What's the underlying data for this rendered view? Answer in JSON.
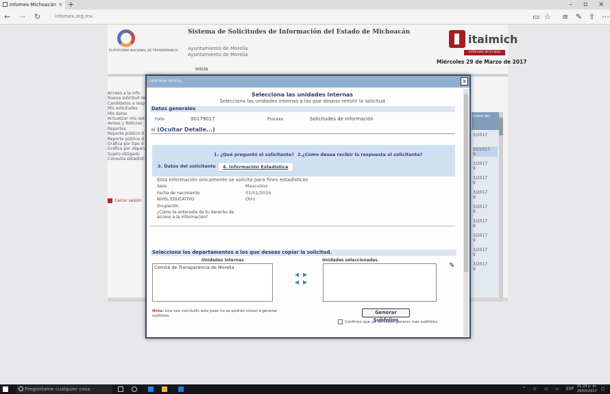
{
  "browser": {
    "tab_title": "Infomex Michoacán",
    "tab_close": "×",
    "new_tab": "+",
    "url": "infomex.org.mx",
    "min": "–",
    "max": "▫",
    "close": "×"
  },
  "page": {
    "logo_text": "PLATAFORMA NACIONAL DE TRANSPARENCIA",
    "site_title": "Sistema de Solicitudes de Información del Estado de Michoacán",
    "org_line1": "Ayuntamiento de Morelia",
    "org_line2": "Ayuntamiento de Morelia",
    "itai_name": "itaimich",
    "itai_tag": "Infórmate de tu lado",
    "date": "Miércoles 29 de Marzo de 2017",
    "inicio": "Inicio",
    "side_menu": [
      "Acceso a la info",
      "Nueva solicitud de",
      "Candidatos a resp",
      "Mis solicitudes",
      "Mis datos",
      "Actualizar mis dat",
      "Avisos y Noticias",
      "Reportes",
      "Reporte público d",
      "Reporte público d",
      "Gráfica por tipo d",
      "Gráfica por depen",
      "Sujeto obligado",
      "Consulta estadísti"
    ],
    "logout": "Cerrar sesión",
    "right_header": "cidad del",
    "right_cells": [
      "3/2017",
      "02/2017\n9",
      "3/2017\n9",
      "3/2017\n9",
      "3/2017\n9",
      "3/2017\n9",
      "3/2017\n9",
      "3/2017\n9",
      "3/2017\n9",
      "3/2017\n9"
    ]
  },
  "modal": {
    "title": "VENTANA MODAL",
    "close": "x",
    "heading": "Selecciona las unidades internas",
    "subheading": "Selecciona las unidades internas a las que deseas remitir la solicitud",
    "section_general": "Datos generales",
    "folio_label": "Folio",
    "folio_value": "00179017",
    "proceso_label": "Proceso",
    "proceso_value": "Solicitudes de Información",
    "toggle": "(Ocultar Detalle...)",
    "tabs": {
      "t1": "1. ¿Qué preguntó el solicitante?",
      "t2": "2.¿Cómo desea recibir la respuesta el solicitante?",
      "t3": "3. Datos del solicitante",
      "t4": "4. Información Estadística"
    },
    "info_note": "Esta información únicamente se solicita para fines estadísticos",
    "fields": [
      {
        "label": "Sexo",
        "value": "Masculino"
      },
      {
        "label": "Fecha de nacimiento",
        "value": "01/01/2016"
      },
      {
        "label": "NIVEL EDUCATIVO",
        "value": "Otro"
      },
      {
        "label": "Ocupación",
        "value": ""
      },
      {
        "label": "¿Cómo te enteraste de tu derecho de acceso a la información?",
        "value": ""
      }
    ],
    "dept_heading": "Selecciona los departamentos a los que deseas copiar la solicitud.",
    "internal_label": "Unidades internas",
    "selected_label": "Unidades seleccionadas",
    "internal_items": [
      "Comité de Transparencia de Morelia"
    ],
    "note_prefix": "Nota:",
    "note_text": "Una vez concluido este paso no se podrán volver a generar subfolios.",
    "generate_button": "Generar Subfolios",
    "confirm_label": "Confirmo que ya no deseo generar más subfolios"
  },
  "taskbar": {
    "search_placeholder": "Pregúntame cualquier cosa",
    "lang": "ESP",
    "time": "01:29 p. m.",
    "date": "29/03/2017"
  },
  "colors": {
    "modal_titlebar": "#8fb0d0",
    "section_bg": "#dbe6f2",
    "brand_red": "#a41d23"
  }
}
